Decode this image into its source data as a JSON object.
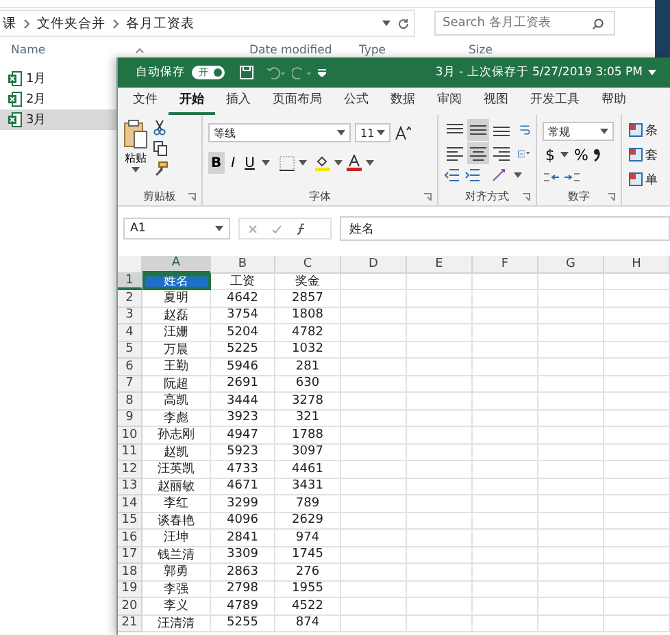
{
  "explorer": {
    "breadcrumb": [
      "课",
      "文件夹合并",
      "各月工资表"
    ],
    "search": {
      "placeholder": "Search 各月工资表"
    },
    "columns": [
      "Name",
      "Date modified",
      "Type",
      "Size"
    ],
    "files": [
      {
        "name": "1月",
        "selected": false
      },
      {
        "name": "2月",
        "selected": false
      },
      {
        "name": "3月",
        "selected": true
      }
    ]
  },
  "excel": {
    "autosave": {
      "label": "自动保存",
      "toggle": "开",
      "on": true
    },
    "title": "3月 - 上次保存于 5/27/2019 3:05 PM",
    "tabs": [
      {
        "label": "文件",
        "selected": false
      },
      {
        "label": "开始",
        "selected": true
      },
      {
        "label": "插入",
        "selected": false
      },
      {
        "label": "页面布局",
        "selected": false
      },
      {
        "label": "公式",
        "selected": false
      },
      {
        "label": "数据",
        "selected": false
      },
      {
        "label": "审阅",
        "selected": false
      },
      {
        "label": "视图",
        "selected": false
      },
      {
        "label": "开发工具",
        "selected": false
      },
      {
        "label": "帮助",
        "selected": false
      }
    ],
    "clipboard_group": {
      "label": "剪贴板",
      "paste": "粘贴"
    },
    "font_group": {
      "label": "字体",
      "font": "等线",
      "size": "11",
      "bold": {
        "text": "B",
        "on": true
      },
      "italic": {
        "text": "I",
        "on": false
      },
      "underline": {
        "text": "U",
        "on": false
      }
    },
    "alignment_group": {
      "label": "对齐方式",
      "buttons": [
        {
          "kind": "top",
          "on": false
        },
        {
          "kind": "middle",
          "on": true
        },
        {
          "kind": "bottom",
          "on": false
        },
        {
          "kind": "left",
          "on": false
        },
        {
          "kind": "center",
          "on": true
        },
        {
          "kind": "right",
          "on": false
        }
      ]
    },
    "number_group": {
      "label": "数字",
      "format": "常规",
      "currency": "$",
      "percent": "%"
    },
    "styles_group": {
      "items": [
        "条",
        "套",
        "单"
      ]
    },
    "name_box": "A1",
    "formula": "姓名",
    "columns": [
      "A",
      "B",
      "C",
      "D",
      "E",
      "F",
      "G",
      "H"
    ],
    "rows": [
      {
        "n": "1",
        "cells": [
          {
            "v": "姓名",
            "selected": true
          },
          {
            "v": "工资",
            "selected": false
          },
          {
            "v": "奖金",
            "selected": false
          }
        ]
      },
      {
        "n": "2",
        "cells": [
          {
            "v": "夏明",
            "selected": false
          },
          {
            "v": "4642",
            "selected": false
          },
          {
            "v": "2857",
            "selected": false
          }
        ]
      },
      {
        "n": "3",
        "cells": [
          {
            "v": "赵磊",
            "selected": false
          },
          {
            "v": "3754",
            "selected": false
          },
          {
            "v": "1808",
            "selected": false
          }
        ]
      },
      {
        "n": "4",
        "cells": [
          {
            "v": "汪姗",
            "selected": false
          },
          {
            "v": "5204",
            "selected": false
          },
          {
            "v": "4782",
            "selected": false
          }
        ]
      },
      {
        "n": "5",
        "cells": [
          {
            "v": "万晨",
            "selected": false
          },
          {
            "v": "5225",
            "selected": false
          },
          {
            "v": "1032",
            "selected": false
          }
        ]
      },
      {
        "n": "6",
        "cells": [
          {
            "v": "王勤",
            "selected": false
          },
          {
            "v": "5946",
            "selected": false
          },
          {
            "v": "281",
            "selected": false
          }
        ]
      },
      {
        "n": "7",
        "cells": [
          {
            "v": "阮超",
            "selected": false
          },
          {
            "v": "2691",
            "selected": false
          },
          {
            "v": "630",
            "selected": false
          }
        ]
      },
      {
        "n": "8",
        "cells": [
          {
            "v": "高凯",
            "selected": false
          },
          {
            "v": "3444",
            "selected": false
          },
          {
            "v": "3278",
            "selected": false
          }
        ]
      },
      {
        "n": "9",
        "cells": [
          {
            "v": "李彪",
            "selected": false
          },
          {
            "v": "3923",
            "selected": false
          },
          {
            "v": "321",
            "selected": false
          }
        ]
      },
      {
        "n": "10",
        "cells": [
          {
            "v": "孙志刚",
            "selected": false
          },
          {
            "v": "4947",
            "selected": false
          },
          {
            "v": "1788",
            "selected": false
          }
        ]
      },
      {
        "n": "11",
        "cells": [
          {
            "v": "赵凯",
            "selected": false
          },
          {
            "v": "5923",
            "selected": false
          },
          {
            "v": "3097",
            "selected": false
          }
        ]
      },
      {
        "n": "12",
        "cells": [
          {
            "v": "汪英凯",
            "selected": false
          },
          {
            "v": "4733",
            "selected": false
          },
          {
            "v": "4461",
            "selected": false
          }
        ]
      },
      {
        "n": "13",
        "cells": [
          {
            "v": "赵丽敏",
            "selected": false
          },
          {
            "v": "4671",
            "selected": false
          },
          {
            "v": "3431",
            "selected": false
          }
        ]
      },
      {
        "n": "14",
        "cells": [
          {
            "v": "李红",
            "selected": false
          },
          {
            "v": "3299",
            "selected": false
          },
          {
            "v": "789",
            "selected": false
          }
        ]
      },
      {
        "n": "15",
        "cells": [
          {
            "v": "谈春艳",
            "selected": false
          },
          {
            "v": "4096",
            "selected": false
          },
          {
            "v": "2629",
            "selected": false
          }
        ]
      },
      {
        "n": "16",
        "cells": [
          {
            "v": "汪坤",
            "selected": false
          },
          {
            "v": "2841",
            "selected": false
          },
          {
            "v": "974",
            "selected": false
          }
        ]
      },
      {
        "n": "17",
        "cells": [
          {
            "v": "钱兰清",
            "selected": false
          },
          {
            "v": "3309",
            "selected": false
          },
          {
            "v": "1745",
            "selected": false
          }
        ]
      },
      {
        "n": "18",
        "cells": [
          {
            "v": "郭勇",
            "selected": false
          },
          {
            "v": "2863",
            "selected": false
          },
          {
            "v": "276",
            "selected": false
          }
        ]
      },
      {
        "n": "19",
        "cells": [
          {
            "v": "李强",
            "selected": false
          },
          {
            "v": "2798",
            "selected": false
          },
          {
            "v": "1955",
            "selected": false
          }
        ]
      },
      {
        "n": "20",
        "cells": [
          {
            "v": "李义",
            "selected": false
          },
          {
            "v": "4789",
            "selected": false
          },
          {
            "v": "4522",
            "selected": false
          }
        ]
      },
      {
        "n": "21",
        "cells": [
          {
            "v": "汪清清",
            "selected": false
          },
          {
            "v": "5255",
            "selected": false
          },
          {
            "v": "874",
            "selected": false
          }
        ]
      }
    ]
  }
}
